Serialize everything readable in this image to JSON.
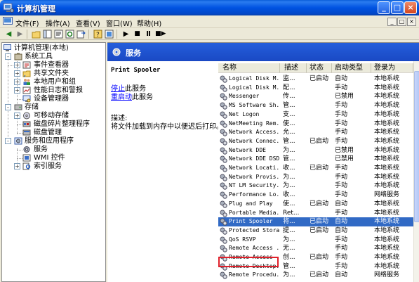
{
  "window": {
    "title": "计算机管理",
    "controls": [
      "_",
      "□",
      "×"
    ]
  },
  "menubar": {
    "items": [
      "文件(F)",
      "操作(A)",
      "查看(V)",
      "窗口(W)",
      "帮助(H)"
    ],
    "mdi_controls": [
      "_",
      "□",
      "×"
    ]
  },
  "toolbar": {
    "icons": [
      "back-icon",
      "forward-icon",
      "up-folder-icon",
      "show-tree-icon",
      "properties-icon",
      "refresh-icon",
      "export-icon",
      "help-icon",
      "console-icon",
      "play-icon",
      "stop-icon",
      "pause-icon",
      "restart-icon"
    ]
  },
  "tree": {
    "root": "计算机管理(本地)",
    "nodes": [
      {
        "label": "系统工具",
        "level": 1,
        "expander": "-"
      },
      {
        "label": "事件查看器",
        "level": 2,
        "expander": "+"
      },
      {
        "label": "共享文件夹",
        "level": 2,
        "expander": "+"
      },
      {
        "label": "本地用户和组",
        "level": 2,
        "expander": "+"
      },
      {
        "label": "性能日志和警报",
        "level": 2,
        "expander": "+"
      },
      {
        "label": "设备管理器",
        "level": 2,
        "expander": ""
      },
      {
        "label": "存储",
        "level": 1,
        "expander": "-"
      },
      {
        "label": "可移动存储",
        "level": 2,
        "expander": "+"
      },
      {
        "label": "磁盘碎片整理程序",
        "level": 2,
        "expander": ""
      },
      {
        "label": "磁盘管理",
        "level": 2,
        "expander": ""
      },
      {
        "label": "服务和应用程序",
        "level": 1,
        "expander": "-"
      },
      {
        "label": "服务",
        "level": 2,
        "expander": ""
      },
      {
        "label": "WMI 控件",
        "level": 2,
        "expander": ""
      },
      {
        "label": "索引服务",
        "level": 2,
        "expander": "+"
      }
    ]
  },
  "right_header": {
    "title": "服务"
  },
  "description": {
    "service_name": "Print Spooler",
    "stop_link": "停止",
    "stop_suffix": "此服务",
    "restart_link": "重启动",
    "restart_suffix": "此服务",
    "desc_label": "描述:",
    "desc_text": "将文件加载到内存中以便迟后打印。"
  },
  "services": {
    "columns": [
      "名称",
      "描述",
      "状态",
      "启动类型",
      "登录为"
    ],
    "rows": [
      {
        "name": "Logical Disk M...",
        "desc": "监...",
        "status": "已启动",
        "startup": "自动",
        "logon": "本地系统"
      },
      {
        "name": "Logical Disk M...",
        "desc": "配...",
        "status": "",
        "startup": "手动",
        "logon": "本地系统"
      },
      {
        "name": "Messenger",
        "desc": "传...",
        "status": "",
        "startup": "已禁用",
        "logon": "本地系统"
      },
      {
        "name": "MS Software Sh...",
        "desc": "管...",
        "status": "",
        "startup": "手动",
        "logon": "本地系统"
      },
      {
        "name": "Net Logon",
        "desc": "支...",
        "status": "",
        "startup": "手动",
        "logon": "本地系统"
      },
      {
        "name": "NetMeeting Rem...",
        "desc": "使...",
        "status": "",
        "startup": "手动",
        "logon": "本地系统"
      },
      {
        "name": "Network Access...",
        "desc": "允...",
        "status": "",
        "startup": "手动",
        "logon": "本地系统"
      },
      {
        "name": "Network Connec...",
        "desc": "管...",
        "status": "已启动",
        "startup": "手动",
        "logon": "本地系统"
      },
      {
        "name": "Network DDE",
        "desc": "为...",
        "status": "",
        "startup": "已禁用",
        "logon": "本地系统"
      },
      {
        "name": "Network DDE DSDM",
        "desc": "管...",
        "status": "",
        "startup": "已禁用",
        "logon": "本地系统"
      },
      {
        "name": "Network Locati...",
        "desc": "收...",
        "status": "已启动",
        "startup": "手动",
        "logon": "本地系统"
      },
      {
        "name": "Network Provis...",
        "desc": "为...",
        "status": "",
        "startup": "手动",
        "logon": "本地系统"
      },
      {
        "name": "NT LM Security...",
        "desc": "为...",
        "status": "",
        "startup": "手动",
        "logon": "本地系统"
      },
      {
        "name": "Performance Lo...",
        "desc": "收...",
        "status": "",
        "startup": "手动",
        "logon": "网络服务"
      },
      {
        "name": "Plug and Play",
        "desc": "使...",
        "status": "已启动",
        "startup": "自动",
        "logon": "本地系统"
      },
      {
        "name": "Portable Media...",
        "desc": "Ret...",
        "status": "",
        "startup": "手动",
        "logon": "本地系统"
      },
      {
        "name": "Print Spooler",
        "desc": "将...",
        "status": "已启动",
        "startup": "自动",
        "logon": "本地系统",
        "selected": true
      },
      {
        "name": "Protected Storage",
        "desc": "提...",
        "status": "已启动",
        "startup": "自动",
        "logon": "本地系统"
      },
      {
        "name": "QoS RSVP",
        "desc": "为...",
        "status": "",
        "startup": "手动",
        "logon": "本地系统"
      },
      {
        "name": "Remote Access ...",
        "desc": "无...",
        "status": "",
        "startup": "手动",
        "logon": "本地系统"
      },
      {
        "name": "Remote Access ...",
        "desc": "创...",
        "status": "已启动",
        "startup": "手动",
        "logon": "本地系统"
      },
      {
        "name": "Remote Desktop...",
        "desc": "管...",
        "status": "",
        "startup": "手动",
        "logon": "本地系统"
      },
      {
        "name": "Remote Procedu...",
        "desc": "为...",
        "status": "已启动",
        "startup": "自动",
        "logon": "网络服务"
      }
    ]
  }
}
